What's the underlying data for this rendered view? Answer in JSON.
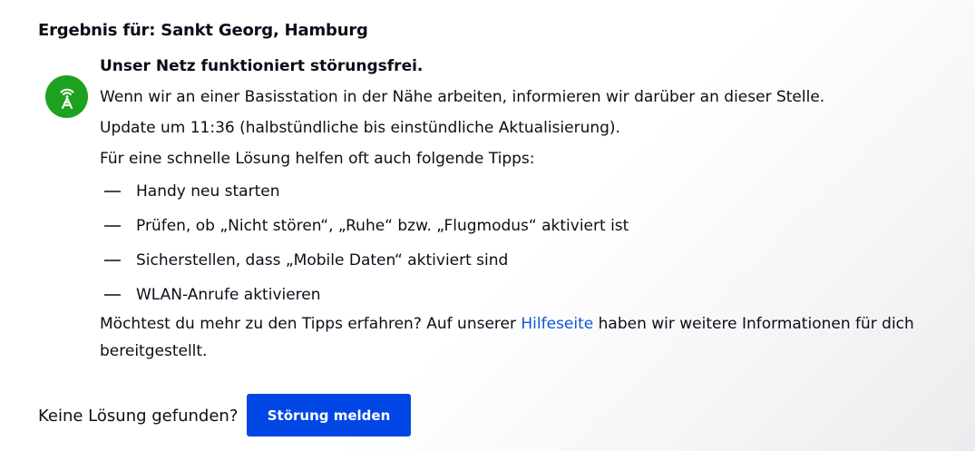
{
  "result": {
    "title": "Ergebnis für: Sankt Georg, Hamburg"
  },
  "status": {
    "icon": "antenna-icon",
    "color": "#1ea11e",
    "headline": "Unser Netz funktioniert störungsfrei.",
    "info": "Wenn wir an einer Basisstation in der Nähe arbeiten, informieren wir darüber an dieser Stelle.",
    "update": "Update um 11:36 (halbstündliche bis einstündliche Aktualisierung).",
    "tips_intro": "Für eine schnelle Lösung helfen oft auch folgende Tipps:",
    "tips": [
      "Handy neu starten",
      "Prüfen, ob „Nicht stören“, „Ruhe“ bzw. „Flugmodus“ aktiviert ist",
      "Sicherstellen, dass „Mobile Daten“ aktiviert sind",
      "WLAN-Anrufe aktivieren"
    ],
    "more_before": "Möchtest du mehr zu den Tipps erfahren? Auf unserer ",
    "more_link": "Hilfeseite",
    "more_after": " haben wir weitere Informationen für dich bereitgestellt."
  },
  "footer": {
    "label": "Keine Lösung gefunden?",
    "button_label": "Störung melden",
    "button_color": "#0047e6"
  }
}
